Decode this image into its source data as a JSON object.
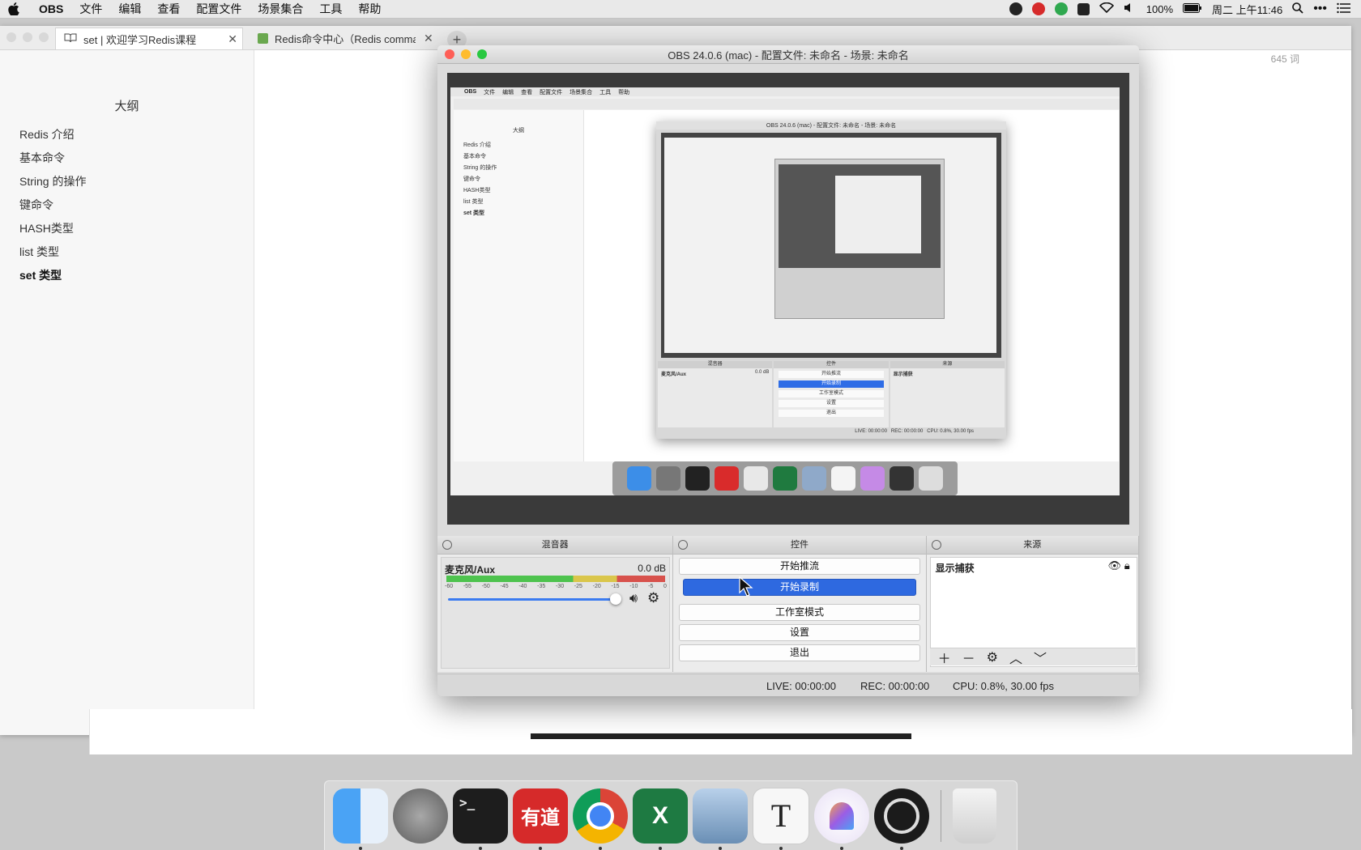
{
  "menubar": {
    "app_name": "OBS",
    "items": [
      "文件",
      "编辑",
      "查看",
      "配置文件",
      "场景集合",
      "工具",
      "帮助"
    ],
    "battery": "100%",
    "clock": "周二 上午11:46"
  },
  "doc_window": {
    "tabs": [
      {
        "label": "set | 欢迎学习Redis课程"
      },
      {
        "label": "Redis命令中心（Redis comman"
      }
    ],
    "word_count": "645 词",
    "outline": {
      "title": "大纲",
      "items": [
        "Redis 介绍",
        "基本命令",
        "String 的操作",
        "键命令",
        "HASH类型",
        "list 类型",
        "set 类型"
      ]
    }
  },
  "obs": {
    "title": "OBS 24.0.6 (mac) - 配置文件: 未命名 - 场景: 未命名",
    "mixer": {
      "header": "混音器",
      "source_name": "麦克风/Aux",
      "level": "0.0 dB",
      "scale": [
        "-60",
        "-55",
        "-50",
        "-45",
        "-40",
        "-35",
        "-30",
        "-25",
        "-20",
        "-15",
        "-10",
        "-5",
        "0"
      ]
    },
    "controls": {
      "header": "控件",
      "start_stream": "开始推流",
      "start_record": "开始录制",
      "studio_mode": "工作室模式",
      "settings": "设置",
      "exit": "退出"
    },
    "sources": {
      "header": "来源",
      "item": "显示捕获"
    },
    "status": {
      "live": "LIVE: 00:00:00",
      "rec": "REC: 00:00:00",
      "cpu": "CPU: 0.8%, 30.00 fps"
    }
  },
  "colors": {
    "accent_blue": "#2e69e0",
    "traffic_red": "#fe5f57",
    "traffic_yellow": "#febc2e",
    "traffic_green": "#28c840"
  },
  "dock": {
    "apps": [
      "finder-icon",
      "launchpad-icon",
      "terminal-icon",
      "youdao-icon",
      "chrome-icon",
      "excel-icon",
      "preview-icon",
      "typora-icon",
      "elephant-icon",
      "obs-icon",
      "trash-icon"
    ],
    "youdao_label": "有道",
    "excel_label": "X",
    "typora_label": "T",
    "terminal_label": ">_"
  }
}
